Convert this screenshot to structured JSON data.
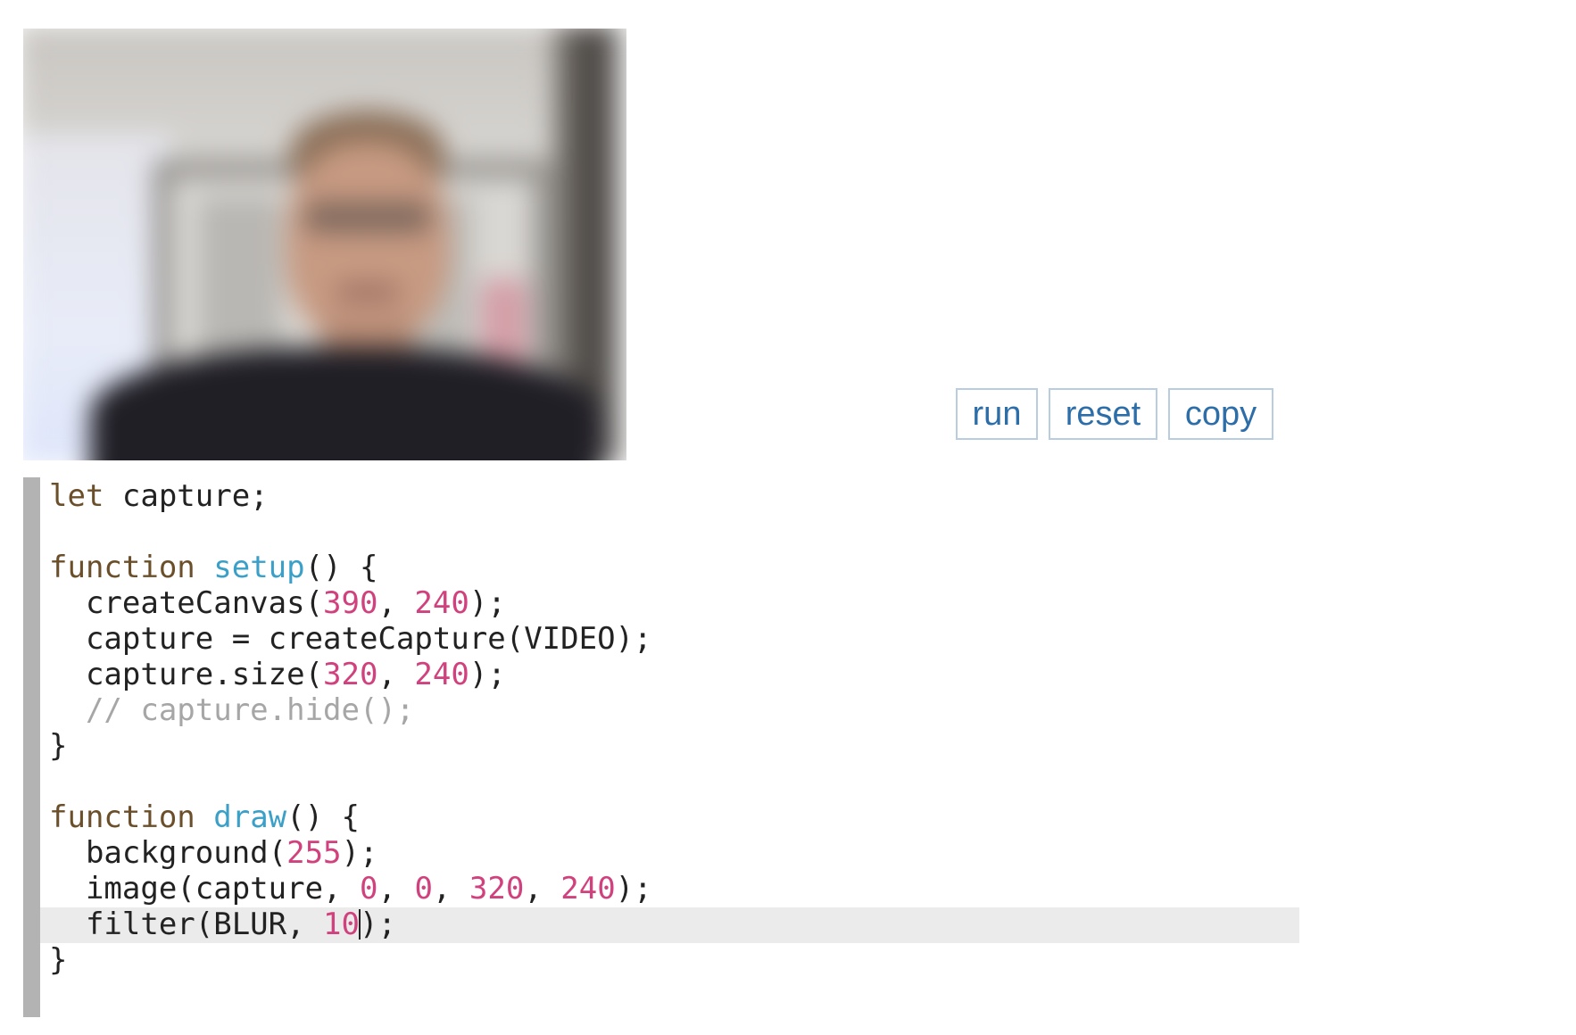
{
  "toolbar": {
    "run_label": "run",
    "reset_label": "reset",
    "copy_label": "copy"
  },
  "editor": {
    "active_line": 13,
    "lines": [
      [
        {
          "t": "let",
          "k": "kw"
        },
        {
          "t": " capture;",
          "k": "var"
        }
      ],
      [],
      [
        {
          "t": "function",
          "k": "kw"
        },
        {
          "t": " ",
          "k": "var"
        },
        {
          "t": "setup",
          "k": "def"
        },
        {
          "t": "() {",
          "k": "var"
        }
      ],
      [
        {
          "t": "  createCanvas(",
          "k": "var"
        },
        {
          "t": "390",
          "k": "num"
        },
        {
          "t": ", ",
          "k": "var"
        },
        {
          "t": "240",
          "k": "num"
        },
        {
          "t": ");",
          "k": "var"
        }
      ],
      [
        {
          "t": "  capture = createCapture(VIDEO);",
          "k": "var"
        }
      ],
      [
        {
          "t": "  capture.size(",
          "k": "var"
        },
        {
          "t": "320",
          "k": "num"
        },
        {
          "t": ", ",
          "k": "var"
        },
        {
          "t": "240",
          "k": "num"
        },
        {
          "t": ");",
          "k": "var"
        }
      ],
      [
        {
          "t": "  // capture.hide();",
          "k": "com"
        }
      ],
      [
        {
          "t": "}",
          "k": "var"
        }
      ],
      [],
      [
        {
          "t": "function",
          "k": "kw"
        },
        {
          "t": " ",
          "k": "var"
        },
        {
          "t": "draw",
          "k": "def"
        },
        {
          "t": "() {",
          "k": "var"
        }
      ],
      [
        {
          "t": "  background(",
          "k": "var"
        },
        {
          "t": "255",
          "k": "num"
        },
        {
          "t": ");",
          "k": "var"
        }
      ],
      [
        {
          "t": "  image(capture, ",
          "k": "var"
        },
        {
          "t": "0",
          "k": "num"
        },
        {
          "t": ", ",
          "k": "var"
        },
        {
          "t": "0",
          "k": "num"
        },
        {
          "t": ", ",
          "k": "var"
        },
        {
          "t": "320",
          "k": "num"
        },
        {
          "t": ", ",
          "k": "var"
        },
        {
          "t": "240",
          "k": "num"
        },
        {
          "t": ");",
          "k": "var"
        }
      ],
      [
        {
          "t": "  filter(BLUR, ",
          "k": "var"
        },
        {
          "t": "10",
          "k": "num"
        },
        {
          "t": "|",
          "k": "cursor"
        },
        {
          "t": ");",
          "k": "var"
        }
      ],
      [
        {
          "t": "}",
          "k": "var"
        }
      ]
    ]
  },
  "colors": {
    "keyword": "#6b4f2a",
    "definition": "#3aa0c8",
    "number": "#d0417e",
    "comment": "#a6a6a6",
    "button_text": "#2d6ea8",
    "button_border": "#b9cde0",
    "gutter": "#b3b3b3",
    "active_line": "#ebebeb"
  }
}
